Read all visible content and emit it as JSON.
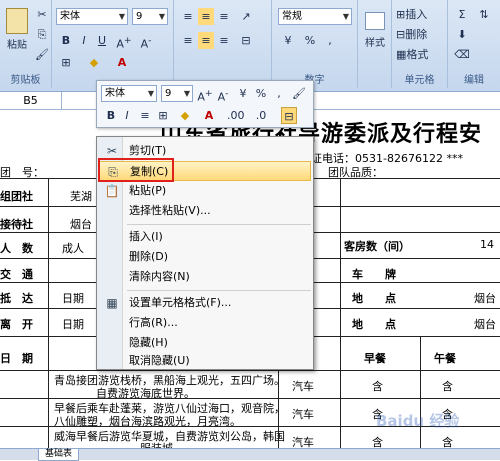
{
  "ribbon": {
    "paste_label": "粘贴",
    "clipboard_label": "剪贴板",
    "font_name": "宋体",
    "font_size": "9",
    "number_format": "常规",
    "number_label": "数字",
    "styles_label": "样式",
    "insert_label": "插入",
    "delete_label": "删除",
    "format_label": "格式",
    "cells_label": "单元格",
    "edit_label": "编辑",
    "currency_symbol": "%",
    "comma_symbol": ","
  },
  "formula_bar": {
    "name_box": "B5"
  },
  "mini_toolbar": {
    "font_name": "宋体",
    "font_size": "9",
    "percent": "%",
    "comma": ","
  },
  "sheet": {
    "title": "山东省旅行社导游委派及行程安",
    "verify_phone": "*** 验证电话：0531-82676122 ***",
    "group_quality": "团队品质：",
    "rows": {
      "group_no": "团　号：",
      "organizer": "组团社",
      "organizer_val": "芜湖",
      "receiver": "接待社",
      "receiver_val": "烟台",
      "people": "人　数",
      "people_val": "成人",
      "rooms": "客房数（间）",
      "rooms_val": "14",
      "traffic": "交　通",
      "vehicle": "车　　牌",
      "arrive": "抵　达",
      "arrive_date": "日期",
      "arrive_place": "地　　点",
      "arrive_city": "烟台",
      "depart": "离　开",
      "depart_date": "日期",
      "depart_place": "地　　点",
      "depart_city": "烟台",
      "date": "日　期",
      "breakfast": "早餐",
      "lunch": "午餐"
    },
    "itinerary": [
      {
        "desc1": "青岛接团游览栈桥，黑船海上观光，五四广场。",
        "desc2": "自费游览海底世界。",
        "traffic": "汽车",
        "breakfast": "含",
        "lunch": "含"
      },
      {
        "desc1": "早餐后乘车赴蓬莱，游览八仙过海口，观音院，",
        "desc2": "八仙雕塑，烟台海滨路观光，月亮湾。",
        "traffic": "汽车",
        "breakfast": "含",
        "lunch": "含"
      },
      {
        "desc1": "威海早餐后游览华夏城，自费游览刘公岛，韩国",
        "desc2": "服装城。",
        "traffic": "汽车",
        "breakfast": "含",
        "lunch": "含"
      }
    ]
  },
  "context_menu": {
    "items": [
      {
        "label": "剪切(T)",
        "icon": "scissors-icon"
      },
      {
        "label": "复制(C)",
        "icon": "copy-icon"
      },
      {
        "label": "粘贴(P)",
        "icon": "paste-icon"
      },
      {
        "label": "选择性粘贴(V)...",
        "icon": ""
      },
      {
        "label": "插入(I)",
        "icon": ""
      },
      {
        "label": "删除(D)",
        "icon": ""
      },
      {
        "label": "清除内容(N)",
        "icon": ""
      },
      {
        "label": "设置单元格格式(F)...",
        "icon": "format-cells-icon"
      },
      {
        "label": "行高(R)...",
        "icon": ""
      },
      {
        "label": "隐藏(H)",
        "icon": ""
      },
      {
        "label": "取消隐藏(U)",
        "icon": ""
      }
    ]
  },
  "tabs": {
    "active": "基础表"
  },
  "watermark": "Baidu 经验",
  "colors": {
    "highlight": "#ffd97a",
    "redbox": "#e0201a",
    "ribbon": "#c5d7ee"
  }
}
